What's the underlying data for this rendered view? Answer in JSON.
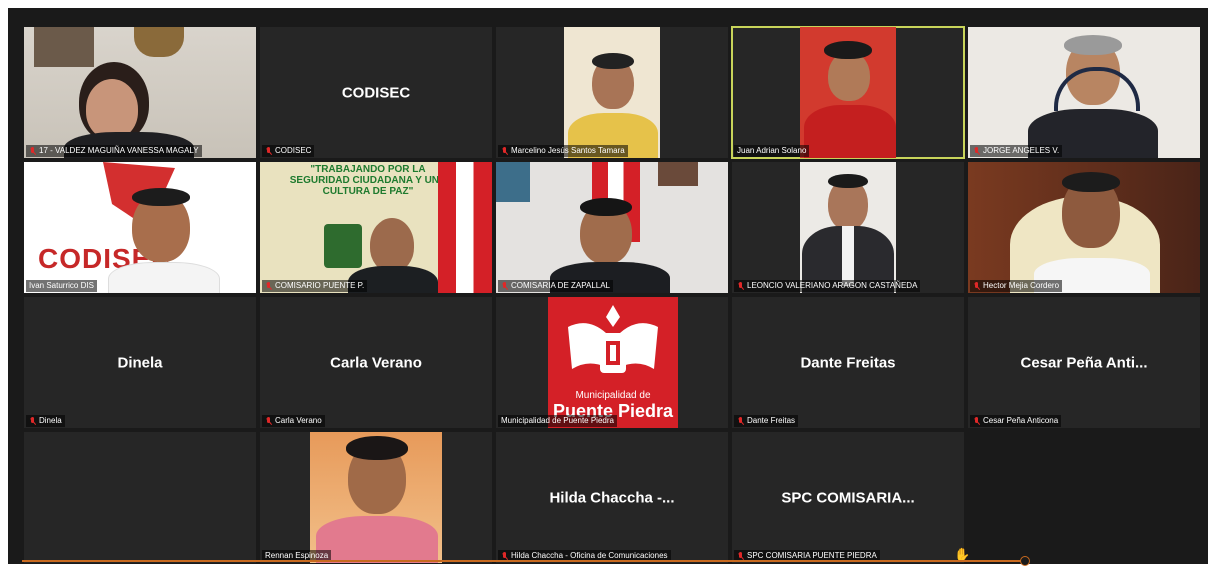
{
  "tiles": [
    {
      "label": "17 - VALDEZ MAGUIÑA VANESSA MAGALY",
      "muted": true
    },
    {
      "label": "CODISEC",
      "center_name": "CODISEC",
      "muted": true
    },
    {
      "label": "Marcelino Jesús Santos Tamara",
      "muted": true
    },
    {
      "label": "Juan Adrian Solano",
      "muted": false,
      "active": true
    },
    {
      "label": "JORGE ANGELES V.",
      "muted": true
    },
    {
      "label": "Ivan Saturrico DIS",
      "muted": false,
      "logo_text": "CODISEC"
    },
    {
      "label": "COMISARIO PUENTE P.",
      "muted": true,
      "banner": "\"TRABAJANDO POR LA SEGURIDAD CIUDADANA Y UNA CULTURA DE PAZ\""
    },
    {
      "label": "COMISARIA DE ZAPALLAL",
      "muted": true
    },
    {
      "label": "LEONCIO VALERIANO ARAGON CASTAÑEDA",
      "muted": true
    },
    {
      "label": "Hector Mejia Cordero",
      "muted": true
    },
    {
      "label": "Dinela",
      "center_name": "Dinela",
      "muted": true
    },
    {
      "label": "Carla Verano",
      "center_name": "Carla Verano",
      "muted": true
    },
    {
      "label": "Municipalidad de Puente Piedra",
      "muted": false,
      "logo_line1": "Municipalidad de",
      "logo_line2": "Puente Piedra"
    },
    {
      "label": "Dante Freitas",
      "center_name": "Dante Freitas",
      "muted": true
    },
    {
      "label": "Cesar Peña Anticona",
      "center_name": "Cesar Peña Anti...",
      "muted": true
    },
    {
      "label": "Rennan Espinoza",
      "muted": false
    },
    {
      "label": "Hilda Chaccha - Oficina de Comunicaciones",
      "center_name": "Hilda Chaccha -...",
      "muted": true
    },
    {
      "label": "SPC COMISARIA PUENTE PIEDRA",
      "center_name": "SPC COMISARIA...",
      "muted": true
    }
  ],
  "colors": {
    "background": "#1a1a1a",
    "tile": "#262626",
    "active_speaker": "#c8d45a",
    "muted_icon": "#e02828",
    "muni_red": "#d42027"
  },
  "icons": {
    "muted": "mic-muted-icon",
    "raise_hand": "raised-hand-icon"
  }
}
